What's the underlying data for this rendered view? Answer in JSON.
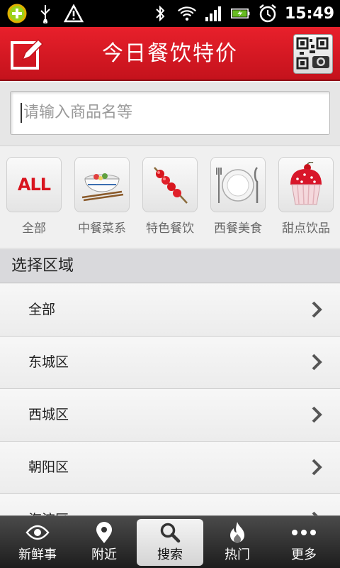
{
  "status_bar": {
    "time": "15:49"
  },
  "header": {
    "title": "今日餐饮特价"
  },
  "search": {
    "placeholder": "请输入商品名等"
  },
  "categories": [
    {
      "label": "全部",
      "icon": "all-icon",
      "icon_text": "ALL"
    },
    {
      "label": "中餐菜系",
      "icon": "chinese-food-bowl-icon"
    },
    {
      "label": "特色餐饮",
      "icon": "skewer-icon"
    },
    {
      "label": "西餐美食",
      "icon": "western-plate-icon"
    },
    {
      "label": "甜点饮品",
      "icon": "cupcake-icon"
    }
  ],
  "region": {
    "title": "选择区域",
    "items": [
      "全部",
      "东城区",
      "西城区",
      "朝阳区",
      "海淀区"
    ]
  },
  "bottom_nav": [
    {
      "label": "新鲜事",
      "icon": "eye-icon",
      "active": false
    },
    {
      "label": "附近",
      "icon": "location-pin-icon",
      "active": false
    },
    {
      "label": "搜索",
      "icon": "search-icon",
      "active": true
    },
    {
      "label": "热门",
      "icon": "flame-icon",
      "active": false
    },
    {
      "label": "更多",
      "icon": "more-dots-icon",
      "active": false
    }
  ],
  "colors": {
    "header_red": "#d81a24",
    "nav_dark": "#2a2a2a"
  }
}
